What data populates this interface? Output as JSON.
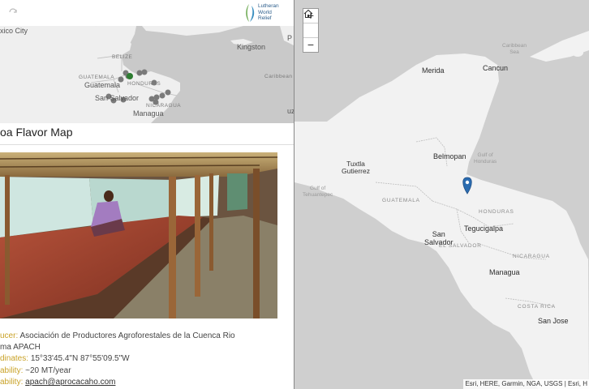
{
  "header": {
    "logo_lines": [
      "Lutheran",
      "World",
      "Relief"
    ]
  },
  "inset_map": {
    "labels": {
      "mexico_city": "xico City",
      "belize": "BELIZE",
      "guatemala_country": "GUATEMALA",
      "guatemala": "Guatemala",
      "honduras": "HONDURAS",
      "san_salvador": "San Salvador",
      "nicaragua": "NICARAGUA",
      "managua": "Managua",
      "kingston": "Kingston",
      "caribbean": "Caribbean",
      "p": "P",
      "uz": "uz"
    }
  },
  "panel": {
    "title": "oa Flavor Map"
  },
  "info": {
    "producer_label": "ucer:",
    "producer_value": "Asociación de Productores Agroforestales de la Cuenca Rio",
    "producer_value_2": "ma APACH",
    "coordinates_label": "dinates:",
    "coordinates_value": "15°33'45.4\"N 87°55'09.5\"W",
    "availability_label": "ability:",
    "availability_value": "~20 MT/year",
    "contact_label": "ability:",
    "contact_value": "apach@aprocacaho.com"
  },
  "main_map": {
    "zoom_in": "+",
    "zoom_out": "−",
    "labels": {
      "merida": "Merida",
      "cancun": "Cancun",
      "caribbean_sea": "Caribbean\nSea",
      "belmopan": "Belmopan",
      "gulf_honduras": "Gulf of\nHonduras",
      "tuxtla": "Tuxtla\nGutierrez",
      "gulf_tehuantepec": "Gulf of\nTehuantepec",
      "guatemala": "GUATEMALA",
      "honduras": "HONDURAS",
      "tegucigalpa": "Tegucigalpa",
      "san_salvador": "San\nSalvador",
      "el_salvador": "EL SALVADOR",
      "nicaragua": "NICARAGUA",
      "managua": "Managua",
      "costa_rica": "COSTA RICA",
      "san_jose": "San Jose"
    },
    "attribution": "Esri, HERE, Garmin, NGA, USGS | Esri, H"
  },
  "colors": {
    "water": "#c9c9c9",
    "land": "#f2f2f2",
    "marker": "#2b6cb0",
    "accent_label": "#c9a227"
  }
}
